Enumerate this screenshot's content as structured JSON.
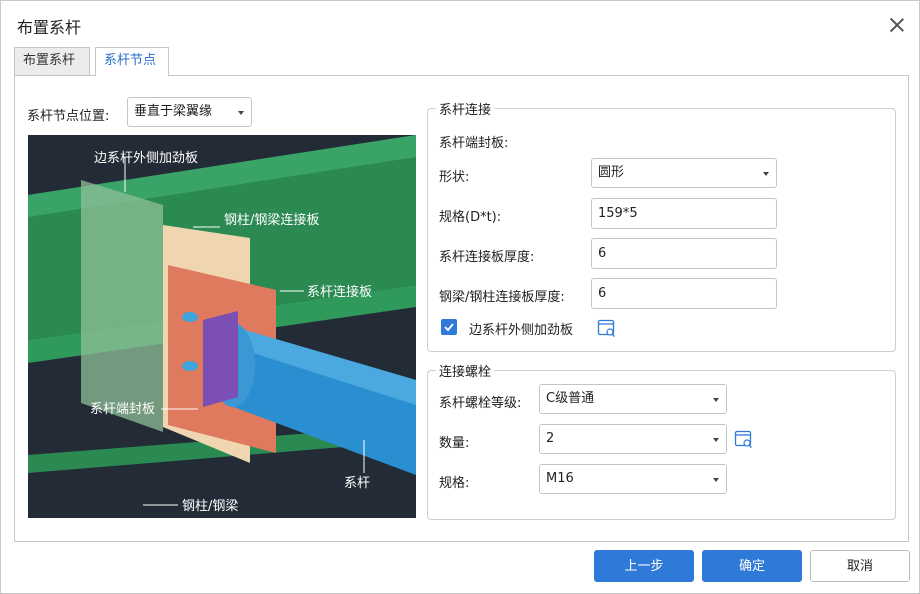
{
  "dialog": {
    "title": "布置系杆",
    "close_icon": "close-icon"
  },
  "tabs": [
    {
      "label": "布置系杆",
      "active": false
    },
    {
      "label": "系杆节点",
      "active": true
    }
  ],
  "node_position": {
    "label": "系杆节点位置:",
    "value": "垂直于梁翼缘"
  },
  "preview": {
    "labels": {
      "side_stiffener": "边系杆外侧加劲板",
      "column_beam_plate": "钢柱/钢梁连接板",
      "tie_plate": "系杆连接板",
      "end_plate": "系杆端封板",
      "tie_bar": "系杆",
      "column_beam": "钢柱/钢梁"
    }
  },
  "tie_connection": {
    "title": "系杆连接",
    "end_plate_heading": "系杆端封板:",
    "shape_label": "形状:",
    "shape_value": "圆形",
    "spec_label": "规格(D*t):",
    "spec_value": "159*5",
    "plate_thickness_label": "系杆连接板厚度:",
    "plate_thickness_value": "6",
    "beam_plate_thickness_label": "钢梁/钢柱连接板厚度:",
    "beam_plate_thickness_value": "6",
    "stiffener_checkbox_label": "边系杆外侧加劲板",
    "stiffener_checked": true
  },
  "bolts": {
    "title": "连接螺栓",
    "grade_label": "系杆螺栓等级:",
    "grade_value": "C级普通",
    "count_label": "数量:",
    "count_value": "2",
    "spec_label": "规格:",
    "spec_value": "M16"
  },
  "buttons": {
    "prev": "上一步",
    "ok": "确定",
    "cancel": "取消"
  },
  "colors": {
    "accent": "#2f7ad9",
    "preview_bg": "#232b36",
    "beam_green": "#2b8a52",
    "end_plate_purple": "#7b4fb3",
    "tie_plate_orange": "#e07a5f",
    "pipe_blue": "#2a8fd0"
  }
}
